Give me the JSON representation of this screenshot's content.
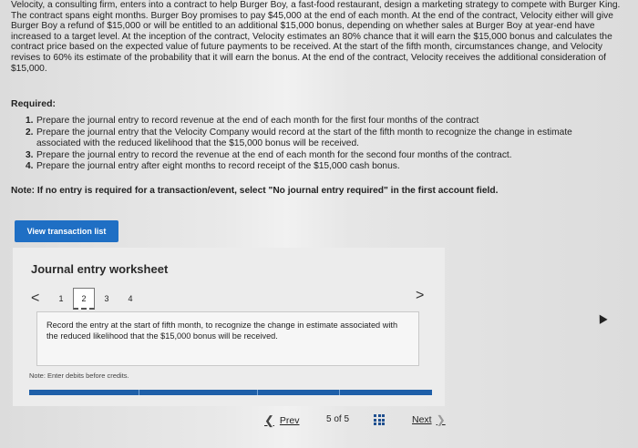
{
  "problem_text": "Velocity, a consulting firm, enters into a contract to help Burger Boy, a fast-food restaurant, design a marketing strategy to compete with Burger King. The contract spans eight months. Burger Boy promises to pay $45,000 at the end of each month. At the end of the contract, Velocity either will give Burger Boy a refund of $15,000 or will be entitled to an additional $15,000 bonus, depending on whether sales at Burger Boy at year-end have increased to a target level. At the inception of the contract, Velocity estimates an 80% chance that it will earn the $15,000 bonus and calculates the contract price based on the expected value of future payments to be received. At the start of the fifth month, circumstances change, and Velocity revises to 60% its estimate of the probability that it will earn the bonus. At the end of the contract, Velocity receives the additional consideration of $15,000.",
  "required_title": "Required:",
  "requirements": [
    {
      "num": "1.",
      "text": "Prepare the journal entry to record revenue at the end of each month for the first four months of the contract"
    },
    {
      "num": "2.",
      "text": "Prepare the journal entry that the Velocity Company would record at the start of the fifth month to recognize the change in estimate associated with the reduced likelihood that the $15,000 bonus will be received."
    },
    {
      "num": "3.",
      "text": "Prepare the journal entry to record the revenue at the end of each month for the second four months of the contract."
    },
    {
      "num": "4.",
      "text": "Prepare the journal entry after eight months to record receipt of the $15,000 cash bonus."
    }
  ],
  "note": "Note: If no entry is required for a transaction/event, select \"No journal entry required\" in the first account field.",
  "view_transaction_label": "View transaction list",
  "worksheet": {
    "title": "Journal entry worksheet",
    "prev_arrow": "<",
    "next_arrow": ">",
    "pages": [
      "1",
      "2",
      "3",
      "4"
    ],
    "active_page": "2",
    "instruction": "Record the entry at the start of fifth month, to recognize the change in estimate associated with the reduced likelihood that the $15,000 bonus will be received.",
    "note": "Note: Enter debits before credits."
  },
  "nav": {
    "prev_label": "Prev",
    "counter": "5 of 5",
    "next_label": "Next",
    "grid_icon": "grid-icon"
  },
  "colors": {
    "accent": "#1f6fc4",
    "bar": "#1e5fa8"
  }
}
